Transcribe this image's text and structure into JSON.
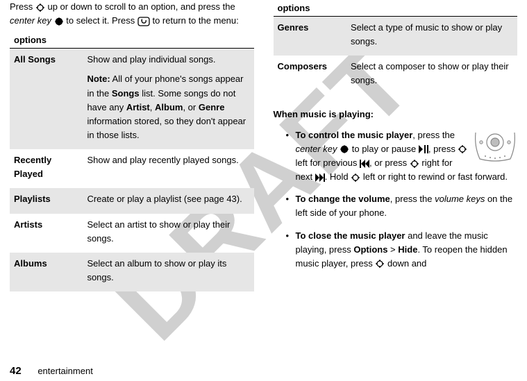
{
  "watermark": "DRAFT",
  "intro": {
    "pre": "Press ",
    "mid1": " up or down to scroll to an option, and press the ",
    "center_key_label": "center key",
    "mid2": " to select it. Press ",
    "post": " to return to the menu:"
  },
  "left_table": {
    "header": "options",
    "rows": [
      {
        "label": "All Songs",
        "desc_plain": "Show and play individual songs.",
        "note_label": "Note:",
        "note_pre": " All of your phone's songs appear in the ",
        "note_songs": "Songs",
        "note_mid1": " list. Some songs do not have any ",
        "note_artist": "Artist",
        "note_sep1": ", ",
        "note_album": "Album",
        "note_sep2": ", or ",
        "note_genre": "Genre",
        "note_post": " information stored, so they don't appear in those lists."
      },
      {
        "label": "Recently Played",
        "desc": "Show and play recently played songs."
      },
      {
        "label": "Playlists",
        "desc": "Create or play a playlist (see page 43)."
      },
      {
        "label": "Artists",
        "desc": "Select an artist to show or play their songs."
      },
      {
        "label": "Albums",
        "desc": "Select an album to show or play its songs."
      }
    ]
  },
  "right_table": {
    "header": "options",
    "rows": [
      {
        "label": "Genres",
        "desc": "Select a type of music to show or play songs."
      },
      {
        "label": "Composers",
        "desc": "Select a composer to show or play their songs."
      }
    ]
  },
  "playing_head": "When music is playing:",
  "bullets": {
    "b1": {
      "lead": "To control the music player",
      "t1": ", press the ",
      "center_key": "center key",
      "t2": " to play or pause ",
      "t3": ", press ",
      "t4": " left for previous ",
      "t5": ", or press ",
      "t6": " right for next ",
      "t7": ". Hold ",
      "t8": " left or right to rewind or fast forward."
    },
    "b2": {
      "lead": "To change the volume",
      "t1": ", press the ",
      "volkeys": "volume keys",
      "t2": " on the left side of your phone."
    },
    "b3": {
      "lead": "To close the music player",
      "t1": " and leave the music playing, press ",
      "options": "Options",
      "gt": " > ",
      "hide": "Hide",
      "t2": ". To reopen the hidden music player, press ",
      "t3": " down and"
    }
  },
  "footer": {
    "page_number": "42",
    "section": "entertainment"
  }
}
